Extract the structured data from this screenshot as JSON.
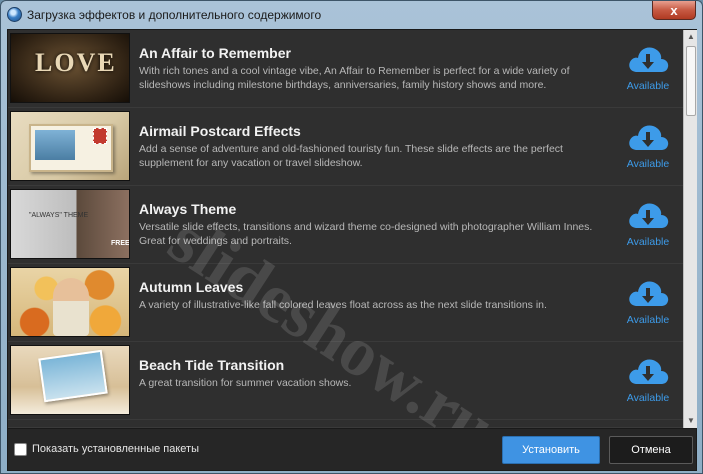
{
  "window": {
    "title": "Загрузка эффектов и дополнительного содержимого",
    "close_glyph": "x"
  },
  "colors": {
    "accent": "#3f93e3",
    "available": "#3d9be9",
    "panel": "#2f2f2f"
  },
  "items": [
    {
      "title": "An Affair to Remember",
      "description": "With rich tones and a cool vintage vibe, An Affair to Remember is perfect for a wide variety of slideshows including milestone birthdays, anniversaries, family history shows and more.",
      "status": "Available",
      "thumb_text": "LOVE"
    },
    {
      "title": "Airmail Postcard Effects",
      "description": "Add a sense of adventure and old-fashioned touristy fun. These slide effects are the perfect supplement for any vacation or travel slideshow.",
      "status": "Available"
    },
    {
      "title": "Always Theme",
      "description": "Versatile slide effects, transitions and wizard theme co-designed with photographer William Innes. Great for weddings and portraits.",
      "status": "Available",
      "thumb_text": "\"ALWAYS\" THEME",
      "thumb_badge": "FREE"
    },
    {
      "title": "Autumn Leaves",
      "description": "A variety of illustrative-like fall colored leaves float across as the next slide transitions in.",
      "status": "Available"
    },
    {
      "title": "Beach Tide Transition",
      "description": "A great transition for summer vacation shows.",
      "status": "Available"
    }
  ],
  "footer": {
    "show_installed_label": "Показать установленные пакеты",
    "install_label": "Установить",
    "cancel_label": "Отмена"
  },
  "watermark": "slideshow.ru",
  "icons": {
    "download": "cloud-download-icon",
    "app": "app-globe-icon"
  }
}
